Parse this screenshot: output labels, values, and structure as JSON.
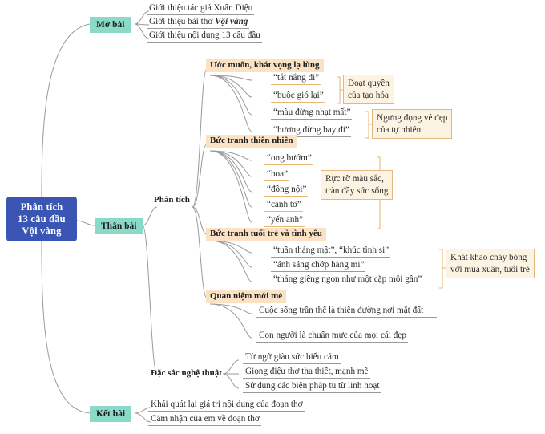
{
  "title": "Sơ đồ tư duy phân tích 13 câu đầu Vội vàng",
  "colors": {
    "root_fill": "#3a55b4",
    "root_text": "#ffffff",
    "branch_fill": "#8ad9c9",
    "section_fill": "#fbe2c4",
    "callout_fill": "#fdf3e3",
    "callout_border": "#e3b77e",
    "line_gray": "#9a9a9a",
    "line_orange": "#e8b877"
  },
  "root": {
    "line1": "Phân tích",
    "line2": "13 câu đầu",
    "line3": "Vội vàng"
  },
  "branches": {
    "mo_bai": {
      "label": "Mở bài",
      "items": [
        {
          "pre": "Giới thiệu tác giả Xuân Diệu",
          "em": "",
          "post": ""
        },
        {
          "pre": "Giới thiệu bài thơ ",
          "em": "Vội vàng",
          "post": ""
        },
        {
          "pre": "Giới thiệu nội dung 13 câu đầu",
          "em": "",
          "post": ""
        }
      ]
    },
    "than_bai": {
      "label": "Thân bài",
      "phan_tich_label": "Phân tích",
      "dac_sac_label": "Đặc sắc nghệ thuật",
      "sections": [
        {
          "header": "Ước muốn, khát vọng lạ lùng",
          "items": [
            "“tắt nắng đi”",
            "“buộc gió lại”",
            "“màu đừng nhạt mất”",
            "“hương đừng bay đi”"
          ],
          "callouts": [
            {
              "line1": "Đoạt quyền",
              "line2": "của tạo hóa"
            },
            {
              "line1": "Ngưng đọng vẻ đẹp",
              "line2": "của tự nhiên"
            }
          ]
        },
        {
          "header": "Bức tranh thiên nhiên",
          "items": [
            "“ong bướm”",
            "“hoa”",
            "“đồng nội”",
            "“cành tơ”",
            "“yến anh”"
          ],
          "callouts": [
            {
              "line1": "Rực rỡ màu sắc,",
              "line2": "tràn đầy sức sống"
            }
          ]
        },
        {
          "header": "Bức tranh tuổi trẻ và tình yêu",
          "items": [
            "“tuần tháng mật”, “khúc tình si”",
            "“ánh sáng chớp hàng mi”",
            "“tháng giêng ngon như một cặp môi gần”"
          ],
          "callouts": [
            {
              "line1": "Khát khao cháy bỏng",
              "line2": "với mùa xuân, tuổi trẻ"
            }
          ]
        },
        {
          "header": "Quan niệm mới mẻ",
          "items": [
            "Cuộc sống trần thế là thiên đường nơi mặt đất",
            "Con người là chuẩn mực của mọi cái đẹp"
          ],
          "callouts": []
        }
      ],
      "dac_sac_items": [
        "Từ ngữ giàu sức biểu cảm",
        "Giọng điệu thơ tha thiết, mạnh mẽ",
        "Sử dụng các biện pháp tu từ linh hoạt"
      ]
    },
    "ket_bai": {
      "label": "Kết bài",
      "items": [
        "Khái quát lại giá trị nội dung của đoạn thơ",
        "Cảm nhận của em về đoạn thơ"
      ]
    }
  }
}
